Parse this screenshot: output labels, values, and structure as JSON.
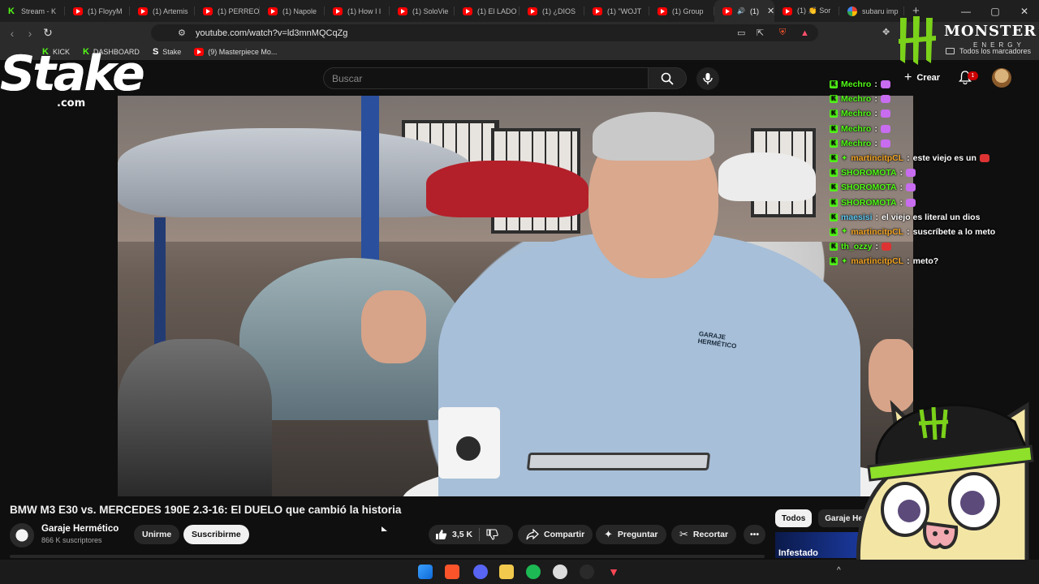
{
  "browser": {
    "tabs": [
      {
        "label": "Stream - K",
        "icon": "kick-icon"
      },
      {
        "label": "(1) FloyyM",
        "icon": "youtube-icon"
      },
      {
        "label": "(1) Artemis",
        "icon": "youtube-icon"
      },
      {
        "label": "(1) PERREO",
        "icon": "youtube-icon"
      },
      {
        "label": "(1) Napole",
        "icon": "youtube-icon"
      },
      {
        "label": "(1) How I l",
        "icon": "youtube-icon"
      },
      {
        "label": "(1) SoloVie",
        "icon": "youtube-icon"
      },
      {
        "label": "(1) El LADO",
        "icon": "youtube-icon"
      },
      {
        "label": "(1) ¿DIOS",
        "icon": "youtube-icon"
      },
      {
        "label": "(1) \"WOJT",
        "icon": "youtube-icon"
      },
      {
        "label": "(1) Group",
        "icon": "youtube-icon"
      },
      {
        "label": "(1)",
        "icon": "youtube-icon",
        "active": true,
        "close": "✕"
      },
      {
        "label": "(1) 👏 Sor",
        "icon": "youtube-icon"
      },
      {
        "label": "subaru imp",
        "icon": "google-icon"
      }
    ],
    "new_tab": "+",
    "url": "youtube.com/watch?v=ld3mnMQCqZg",
    "bookmarks": [
      {
        "label": "KICK",
        "icon": "kick-icon"
      },
      {
        "label": "DASHBOARD",
        "icon": "kick-icon"
      },
      {
        "label": "Stake",
        "icon": "stake-icon"
      },
      {
        "label": "(9) Masterpiece Mo...",
        "icon": "youtube-icon"
      }
    ],
    "all_bookmarks": "Todos los marcadores",
    "window_controls": {
      "minimize": "—",
      "maximize": "▢",
      "close": "✕"
    }
  },
  "youtube": {
    "search_placeholder": "Buscar",
    "create_label": "Crear",
    "notification_count": "1",
    "video": {
      "title": "BMW M3 E30 vs. MERCEDES 190E 2.3-16: El DUELO que cambió la historia",
      "channel": "Garaje Hermético",
      "subscribers": "866 K suscriptores",
      "join_label": "Unirme",
      "subscribe_label": "Suscribirme",
      "likes": "3,5 K",
      "share_label": "Compartir",
      "ask_label": "Preguntar",
      "clip_label": "Recortar",
      "more_label": "•••",
      "shirt_text": "GARAJE HERMÉTICO"
    },
    "chips": [
      {
        "label": "Todos",
        "active": true
      },
      {
        "label": "Garaje He"
      }
    ],
    "related_thumb_text": "Infestado"
  },
  "overlay": {
    "stake_logo": "Stake",
    "stake_domain": ".com",
    "monster_word": "MONSTER",
    "monster_sub": "ENERGY",
    "chat": [
      {
        "user": "Mechro",
        "color": "#53fc18",
        "text": "",
        "emote": "purple"
      },
      {
        "user": "Mechro",
        "color": "#53fc18",
        "text": "",
        "emote": "purple"
      },
      {
        "user": "Mechro",
        "color": "#53fc18",
        "text": "",
        "emote": "purple"
      },
      {
        "user": "Mechro",
        "color": "#53fc18",
        "text": "",
        "emote": "purple"
      },
      {
        "user": "Mechro",
        "color": "#53fc18",
        "text": "",
        "emote": "purple"
      },
      {
        "user": "martincitpCL",
        "color": "#f5a623",
        "text": "este viejo es un",
        "emote": "red",
        "spark": true
      },
      {
        "user": "SHOROMOTA",
        "color": "#53fc18",
        "text": "",
        "emote": "purple"
      },
      {
        "user": "SHOROMOTA",
        "color": "#53fc18",
        "text": "",
        "emote": "purple"
      },
      {
        "user": "SHOROMOTA",
        "color": "#53fc18",
        "text": "",
        "emote": "purple"
      },
      {
        "user": "maesisi",
        "color": "#5ec8f2",
        "text": "el viejo es literal un dios",
        "emote": ""
      },
      {
        "user": "martincitpCL",
        "color": "#f5a623",
        "text": "suscríbete a lo meto",
        "emote": "",
        "spark": true
      },
      {
        "user": "th_ozzy",
        "color": "#53fc18",
        "text": "",
        "emote": "red"
      },
      {
        "user": "martincitpCL",
        "color": "#f5a623",
        "text": "meto?",
        "emote": "",
        "spark": true
      }
    ]
  },
  "taskbar": {
    "icons": [
      "windows-icon",
      "brave-icon",
      "discord-icon",
      "folder-icon",
      "spotify-icon",
      "steam-icon",
      "app-icon",
      "valorant-icon"
    ],
    "tray": "^"
  }
}
